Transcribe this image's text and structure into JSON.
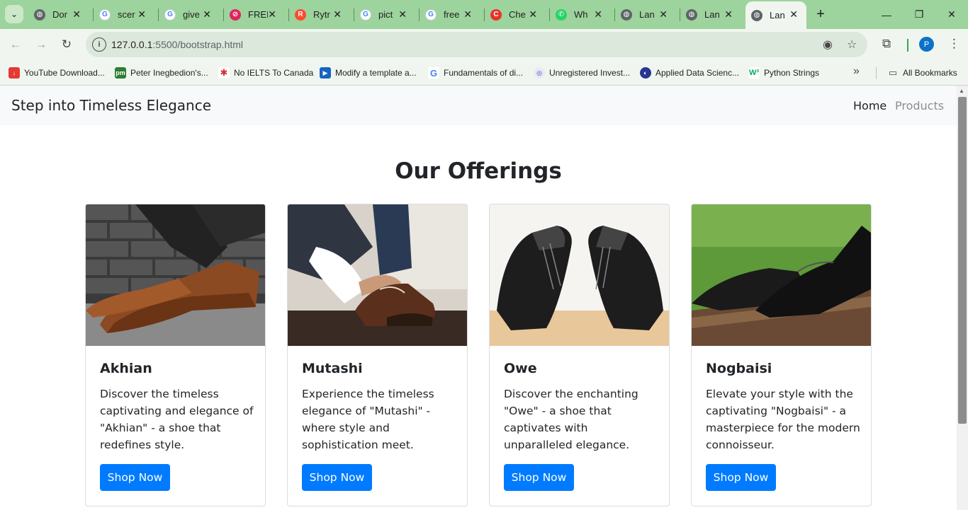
{
  "browser": {
    "tabs": [
      {
        "title": "Dor",
        "favicon": "globe-icon",
        "color": "#5f6368"
      },
      {
        "title": "scer",
        "favicon": "google-icon",
        "color": "#4285f4"
      },
      {
        "title": "give",
        "favicon": "google-icon",
        "color": "#4285f4"
      },
      {
        "title": "FREI",
        "favicon": "slash-icon",
        "color": "#e0245e"
      },
      {
        "title": "Rytr",
        "favicon": "rytr-icon",
        "color": "#ff4a2e"
      },
      {
        "title": "pict",
        "favicon": "google-icon",
        "color": "#4285f4"
      },
      {
        "title": "free",
        "favicon": "google-icon",
        "color": "#4285f4"
      },
      {
        "title": "Che",
        "favicon": "cheggs-icon",
        "color": "#e8332a"
      },
      {
        "title": "Wh",
        "favicon": "whatsapp-icon",
        "color": "#25d366"
      },
      {
        "title": "Lan",
        "favicon": "globe-icon",
        "color": "#5f6368"
      },
      {
        "title": "Lan",
        "favicon": "globe-icon",
        "color": "#5f6368"
      },
      {
        "title": "Lan",
        "favicon": "globe-icon",
        "color": "#5f6368"
      }
    ],
    "url_host": "127.0.0.1",
    "url_path": ":5500/bootstrap.html",
    "profile_initial": "P",
    "bookmarks": [
      {
        "label": "YouTube Download...",
        "icon": "download-icon",
        "color": "#e53935"
      },
      {
        "label": "Peter Inegbedion's...",
        "icon": "pm-icon",
        "color": "#2e7d32"
      },
      {
        "label": "No IELTS To Canada",
        "icon": "maple-leaf-icon",
        "color": "#d32f2f"
      },
      {
        "label": "Modify a template a...",
        "icon": "play-icon",
        "color": "#1565c0"
      },
      {
        "label": "Fundamentals of di...",
        "icon": "google-icon",
        "color": "#4285f4"
      },
      {
        "label": "Unregistered Invest...",
        "icon": "seal-icon",
        "color": "#7986cb"
      },
      {
        "label": "Applied Data Scienc...",
        "icon": "planet-icon",
        "color": "#283593"
      },
      {
        "label": "Python Strings",
        "icon": "w3-icon",
        "color": "#04aa6d"
      }
    ],
    "all_bookmarks_label": "All Bookmarks"
  },
  "page": {
    "brand": "Step into Timeless Elegance",
    "nav": {
      "home": "Home",
      "products": "Products"
    },
    "section_title": "Our Offerings",
    "cards": [
      {
        "title": "Akhian",
        "text": "Discover the timeless captivating and elegance of \"Akhian\" - a shoe that redefines style.",
        "button": "Shop Now"
      },
      {
        "title": "Mutashi",
        "text": "Experience the timeless elegance of \"Mutashi\" - where style and sophistication meet.",
        "button": "Shop Now"
      },
      {
        "title": "Owe",
        "text": "Discover the enchanting \"Owe\" - a shoe that captivates with unparalleled elegance.",
        "button": "Shop Now"
      },
      {
        "title": "Nogbaisi",
        "text": "Elevate your style with the captivating \"Nogbaisi\" - a masterpiece for the modern connoisseur.",
        "button": "Shop Now"
      }
    ],
    "colors": {
      "primary": "#007bff",
      "navbar_bg": "#f8f9fa",
      "tabstrip": "#9dd39c"
    }
  }
}
